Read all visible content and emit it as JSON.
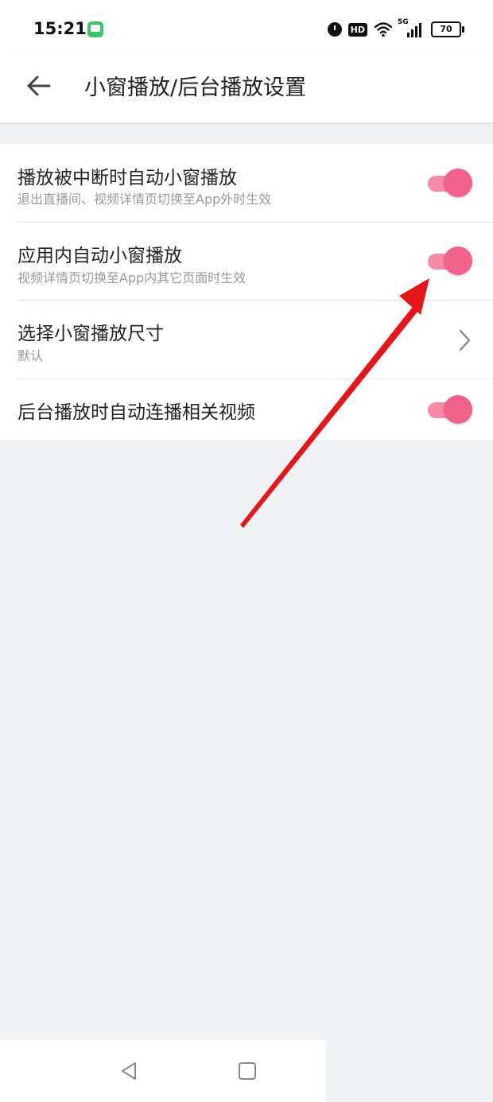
{
  "status_bar": {
    "time": "15:21",
    "icons": [
      "message-app-icon",
      "alarm-icon",
      "hd-icon",
      "wifi-icon",
      "5g-signal-icon",
      "battery-icon"
    ],
    "hd_label": "HD",
    "network_label": "5G",
    "battery": "70"
  },
  "header": {
    "back_icon": "back-arrow-icon",
    "title": "小窗播放/后台播放设置"
  },
  "settings": [
    {
      "title": "播放被中断时自动小窗播放",
      "subtitle": "退出直播间、视频详情页切换至App外时生效",
      "control": "toggle",
      "on": true
    },
    {
      "title": "应用内自动小窗播放",
      "subtitle": "视频详情页切换至App内其它页面时生效",
      "control": "toggle",
      "on": true
    },
    {
      "title": "选择小窗播放尺寸",
      "subtitle": "默认",
      "control": "chevron"
    },
    {
      "title": "后台播放时自动连播相关视频",
      "control": "toggle",
      "on": true
    }
  ],
  "nav_bar": {
    "icons": [
      "nav-back-icon",
      "nav-home-icon"
    ]
  },
  "colors": {
    "toggle_on_knob": "#f0628c",
    "toggle_on_track": "#f78aa6",
    "annotation_arrow": "#e5161b",
    "page_background": "#f0f1f3"
  }
}
